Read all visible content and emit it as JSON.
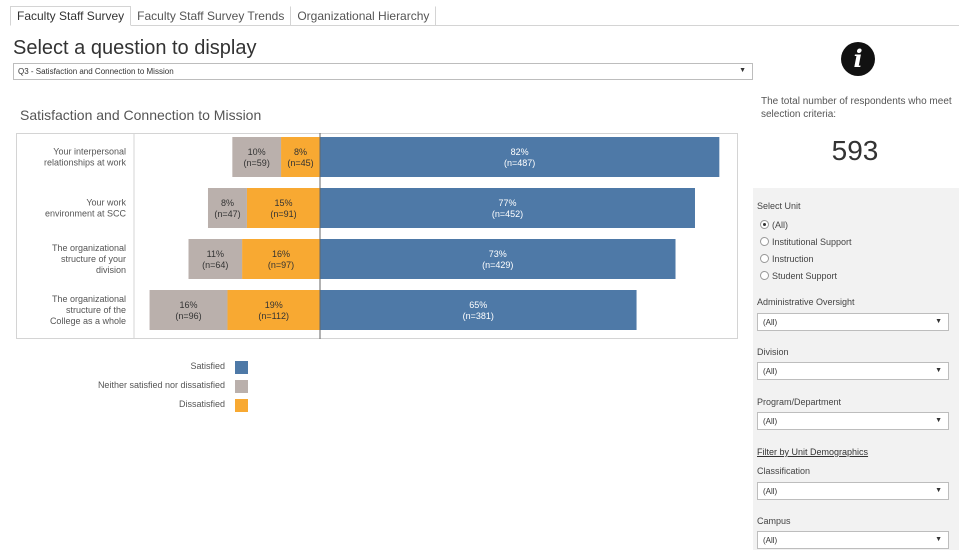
{
  "tabs": [
    "Faculty Staff Survey",
    "Faculty Staff Survey Trends",
    "Organizational Hierarchy"
  ],
  "active_tab": 0,
  "page_title": "Select a question to display",
  "question": {
    "selected": "Q3 - Satisfaction and Connection to Mission",
    "caret": "▼"
  },
  "chart_title": "Satisfaction and Connection to Mission",
  "chart_data": {
    "type": "bar",
    "orientation": "horizontal-diverging",
    "categories": [
      "Your interpersonal relationships at work",
      "Your work environment at SCC",
      "The organizational structure of your division",
      "The organizational structure of the College as a whole"
    ],
    "category_lines": [
      [
        "Your interpersonal",
        "relationships at work"
      ],
      [
        "Your work",
        "environment at SCC"
      ],
      [
        "The organizational",
        "structure of your",
        "division"
      ],
      [
        "The organizational",
        "structure of the",
        "College as a whole"
      ]
    ],
    "series": [
      {
        "name": "Satisfied",
        "color": "#4e79a7",
        "pct": [
          82,
          77,
          73,
          65
        ],
        "n": [
          487,
          452,
          429,
          381
        ],
        "labels": [
          "82%",
          "77%",
          "73%",
          "65%"
        ],
        "n_labels": [
          "(n=487)",
          "(n=452)",
          "(n=429)",
          "(n=381)"
        ]
      },
      {
        "name": "Neither satisfied nor dissatisfied",
        "color": "#bab0ac",
        "pct": [
          10,
          8,
          11,
          16
        ],
        "n": [
          59,
          47,
          64,
          96
        ],
        "labels": [
          "10%",
          "8%",
          "11%",
          "16%"
        ],
        "n_labels": [
          "(n=59)",
          "(n=47)",
          "(n=64)",
          "(n=96)"
        ]
      },
      {
        "name": "Dissatisfied",
        "color": "#f8a932",
        "pct": [
          8,
          15,
          16,
          19
        ],
        "n": [
          45,
          91,
          97,
          112
        ],
        "labels": [
          "8%",
          "15%",
          "16%",
          "19%"
        ],
        "n_labels": [
          "(n=45)",
          "(n=91)",
          "(n=97)",
          "(n=112)"
        ]
      }
    ],
    "legend_placement": "bottom-left"
  },
  "legend": [
    {
      "label": "Satisfied",
      "color": "#4e79a7"
    },
    {
      "label": "Neither satisfied nor dissatisfied",
      "color": "#bab0ac"
    },
    {
      "label": "Dissatisfied",
      "color": "#f8a932"
    }
  ],
  "info_icon": "info-icon",
  "respondents": {
    "text": "The total number of respondents who meet selection criteria:",
    "count": "593"
  },
  "filters": {
    "unit_label": "Select Unit",
    "unit_options": [
      "(All)",
      "Institutional Support",
      "Instruction",
      "Student Support"
    ],
    "unit_selected": 0,
    "admin_label": "Administrative Oversight",
    "admin_value": "(All)",
    "division_label": "Division",
    "division_value": "(All)",
    "program_label": "Program/Department",
    "program_value": "(All)",
    "demographics_link": "Filter by Unit Demographics",
    "classification_label": "Classification",
    "classification_value": "(All)",
    "campus_label": "Campus",
    "campus_value": "(All)",
    "caret": "▼"
  }
}
